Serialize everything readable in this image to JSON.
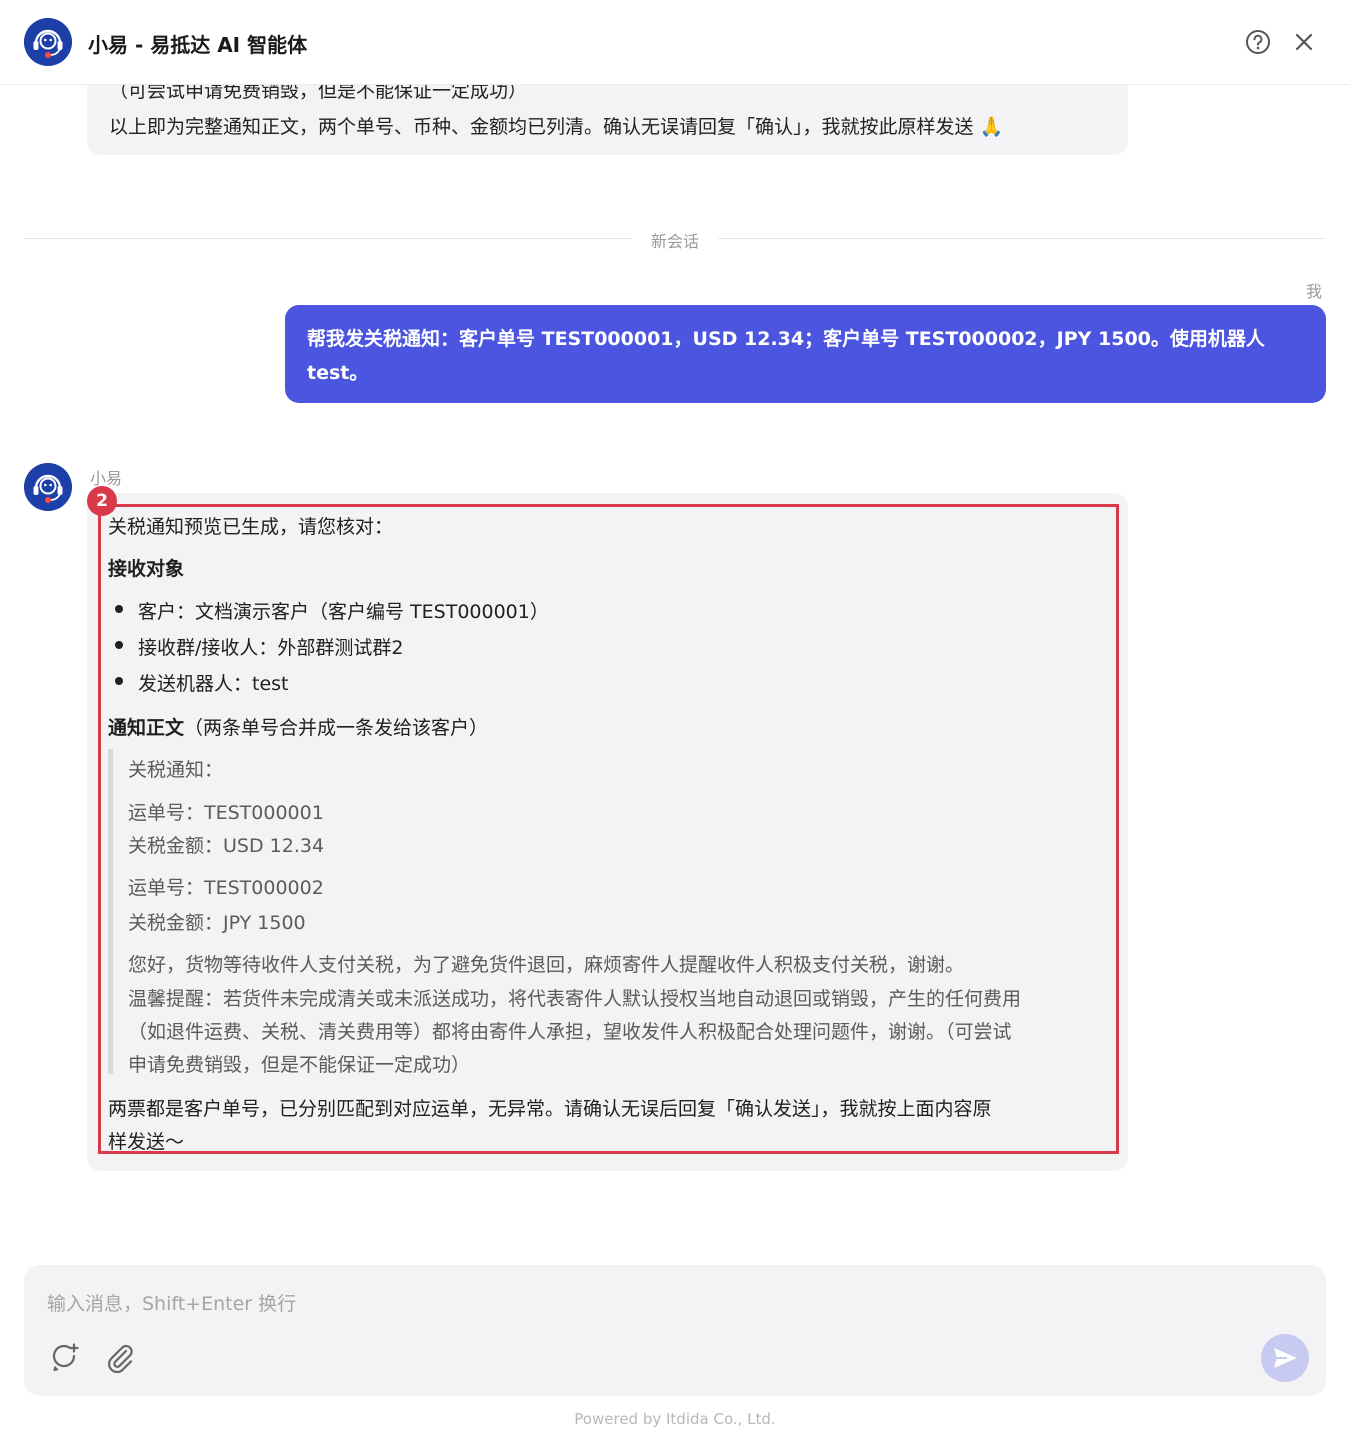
{
  "header": {
    "title": "小易 - 易抵达 AI 智能体",
    "help_icon": "question-circle-icon",
    "close_icon": "close-icon"
  },
  "previous_message": {
    "cut_line": "（可尝试申请免费销毁，但是不能保证一定成功）",
    "last_line": "以上即为完整通知正文，两个单号、币种、金额均已列清。确认无误请回复「确认」，我就按此原样发送 🙏"
  },
  "divider": {
    "label": "新会话"
  },
  "user_message": {
    "sender": "我",
    "text": "帮我发关税通知：客户单号 TEST000001，USD 12.34；客户单号 TEST000002，JPY 1500。使用机器人 test。"
  },
  "bot_message": {
    "sender": "小易",
    "badge": "2",
    "intro": "关税通知预览已生成，请您核对：",
    "recipient_heading": "接收对象",
    "recipients": [
      "客户：文档演示客户（客户编号 TEST000001）",
      "接收群/接收人：外部群测试群2",
      "发送机器人：test"
    ],
    "body_heading": "通知正文",
    "body_heading_note": "（两条单号合并成一条发给该客户）",
    "quote": {
      "title": "关税通知：",
      "waybill1": "运单号：TEST000001",
      "amount1": "关税金额：USD 12.34",
      "waybill2": "运单号：TEST000002",
      "amount2": "关税金额：JPY 1500",
      "para1": "您好，货物等待收件人支付关税，为了避免货件退回，麻烦寄件人提醒收件人积极支付关税，谢谢。",
      "para2_l1": "温馨提醒：若货件未完成清关或未派送成功，将代表寄件人默认授权当地自动退回或销毁，产生的任何费用",
      "para2_l2": "（如退件运费、关税、清关费用等）都将由寄件人承担，望收发件人积极配合处理问题件，谢谢。（可尝试",
      "para2_l3": "申请免费销毁，但是不能保证一定成功）"
    },
    "closing_l1": "两票都是客户单号，已分别匹配到对应运单，无异常。请确认无误后回复「确认发送」，我就按上面内容原",
    "closing_l2": "样发送～"
  },
  "composer": {
    "placeholder": "输入消息，Shift+Enter 换行",
    "new_chat_icon": "new-chat-icon",
    "attach_icon": "paperclip-icon",
    "send_icon": "send-icon"
  },
  "footer": {
    "powered": "Powered by Itdida Co., Ltd."
  },
  "colors": {
    "accent": "#4b55df",
    "bubble_bg": "#f3f3f5",
    "highlight": "#d93a4a",
    "avatar_bg": "#1d3fa8"
  }
}
